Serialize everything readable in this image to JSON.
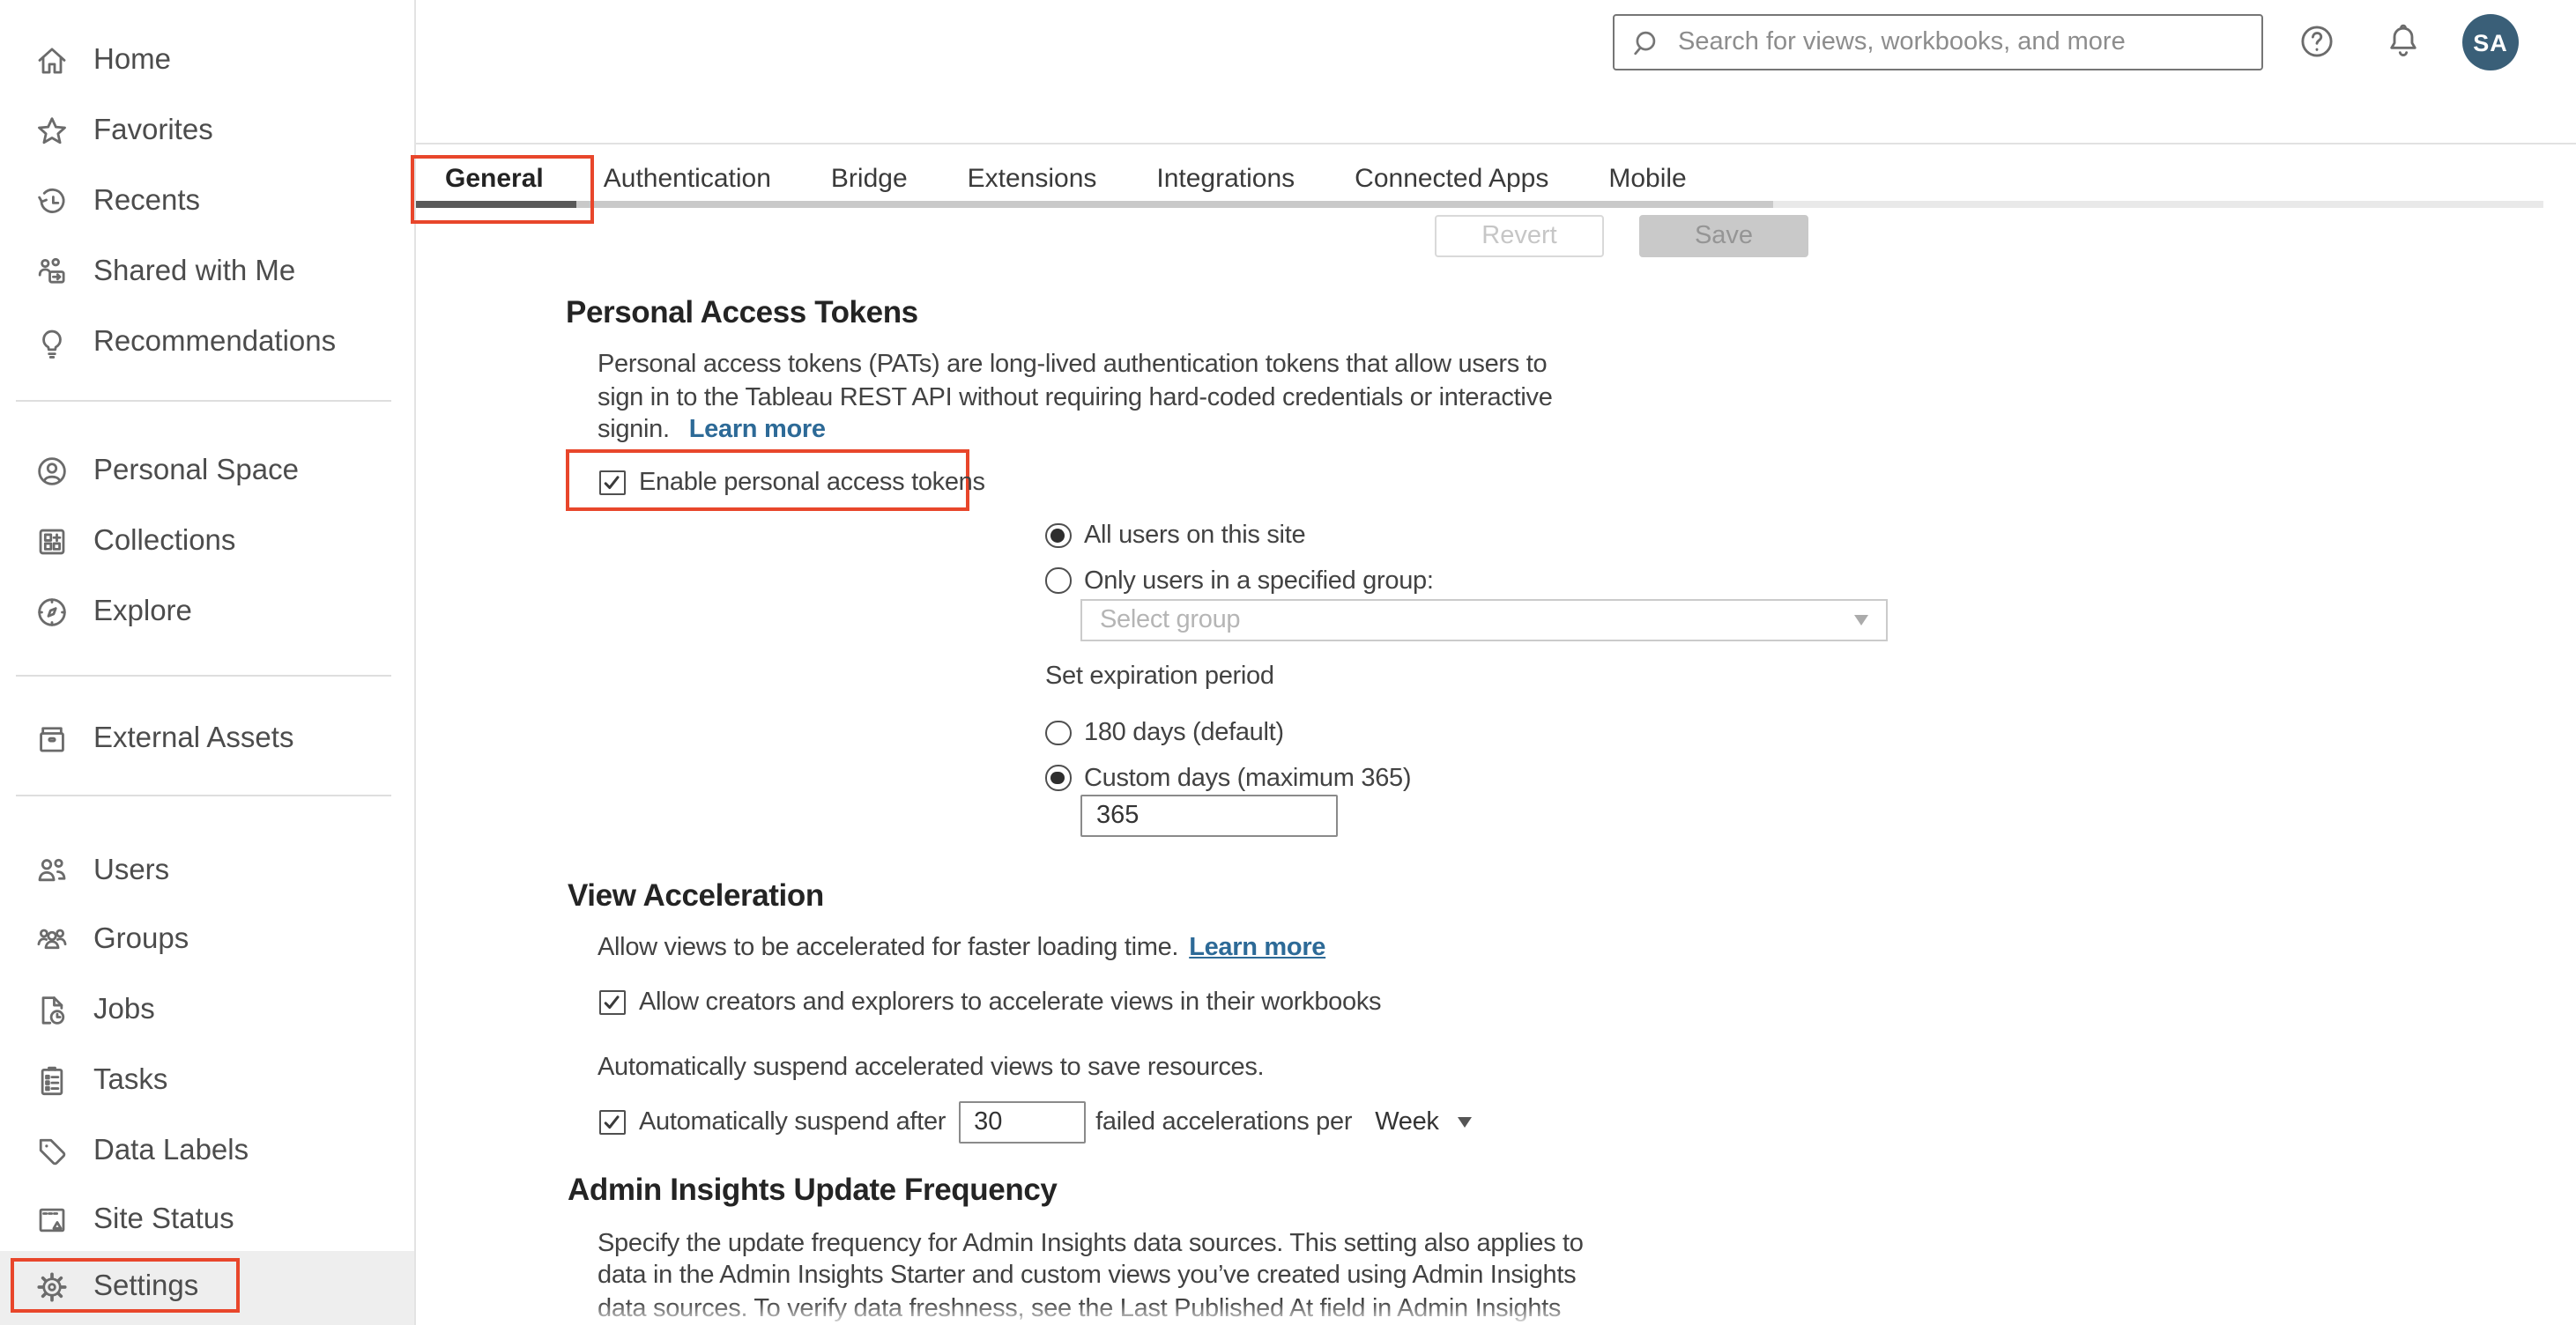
{
  "header": {
    "search_placeholder": "Search for views, workbooks, and more",
    "avatar_initials": "SA"
  },
  "sidebar": {
    "items": [
      {
        "label": "Home",
        "icon": "home-icon"
      },
      {
        "label": "Favorites",
        "icon": "star-icon"
      },
      {
        "label": "Recents",
        "icon": "recents-icon"
      },
      {
        "label": "Shared with Me",
        "icon": "shared-with-me-icon"
      },
      {
        "label": "Recommendations",
        "icon": "lightbulb-icon"
      },
      {
        "label": "Personal Space",
        "icon": "person-circle-icon"
      },
      {
        "label": "Collections",
        "icon": "collections-icon"
      },
      {
        "label": "Explore",
        "icon": "compass-icon"
      },
      {
        "label": "External Assets",
        "icon": "archive-icon"
      },
      {
        "label": "Users",
        "icon": "users-icon"
      },
      {
        "label": "Groups",
        "icon": "groups-icon"
      },
      {
        "label": "Jobs",
        "icon": "jobs-icon"
      },
      {
        "label": "Tasks",
        "icon": "tasks-icon"
      },
      {
        "label": "Data Labels",
        "icon": "tag-icon"
      },
      {
        "label": "Site Status",
        "icon": "site-status-icon"
      },
      {
        "label": "Settings",
        "icon": "gear-icon"
      }
    ]
  },
  "tabs": {
    "items": [
      "General",
      "Authentication",
      "Bridge",
      "Extensions",
      "Integrations",
      "Connected Apps",
      "Mobile"
    ],
    "active": "General"
  },
  "toolbar": {
    "revert_label": "Revert",
    "save_label": "Save"
  },
  "sections": {
    "pat": {
      "heading": "Personal Access Tokens",
      "desc_lines": [
        "Personal access tokens (PATs) are long-lived authentication tokens that allow users to",
        "sign in to the Tableau REST API without requiring hard-coded credentials or interactive",
        "signin."
      ],
      "learn_more": "Learn more",
      "enable_label": "Enable personal access tokens",
      "radio_all_users": "All users on this site",
      "radio_specified_group": "Only users in a specified group:",
      "group_select_placeholder": "Select group",
      "expiration_label": "Set expiration period",
      "radio_default_days": "180 days (default)",
      "radio_custom_days": "Custom days (maximum 365)",
      "custom_days_value": "365"
    },
    "view_acceleration": {
      "heading": "View Acceleration",
      "desc": "Allow views to be accelerated for faster loading time.",
      "learn_more": "Learn more",
      "allow_checkbox_label": "Allow creators and explorers to accelerate views in their workbooks",
      "suspend_desc": "Automatically suspend accelerated views to save resources.",
      "suspend_prefix": "Automatically suspend after",
      "failed_value": "30",
      "suspend_suffix": "failed accelerations per",
      "period_value": "Week"
    },
    "admin_insights": {
      "heading": "Admin Insights Update Frequency",
      "desc_lines": [
        "Specify the update frequency for Admin Insights data sources. This setting also applies to",
        "data in the Admin Insights Starter and custom views you’ve created using Admin Insights",
        "data sources. To verify data freshness, see the Last Published At field in Admin Insights"
      ]
    }
  },
  "colors": {
    "annotation_red": "#e8462b",
    "link_blue": "#2d6a97",
    "avatar_bg": "#3a5f78",
    "tab_indicator": "#595959"
  }
}
